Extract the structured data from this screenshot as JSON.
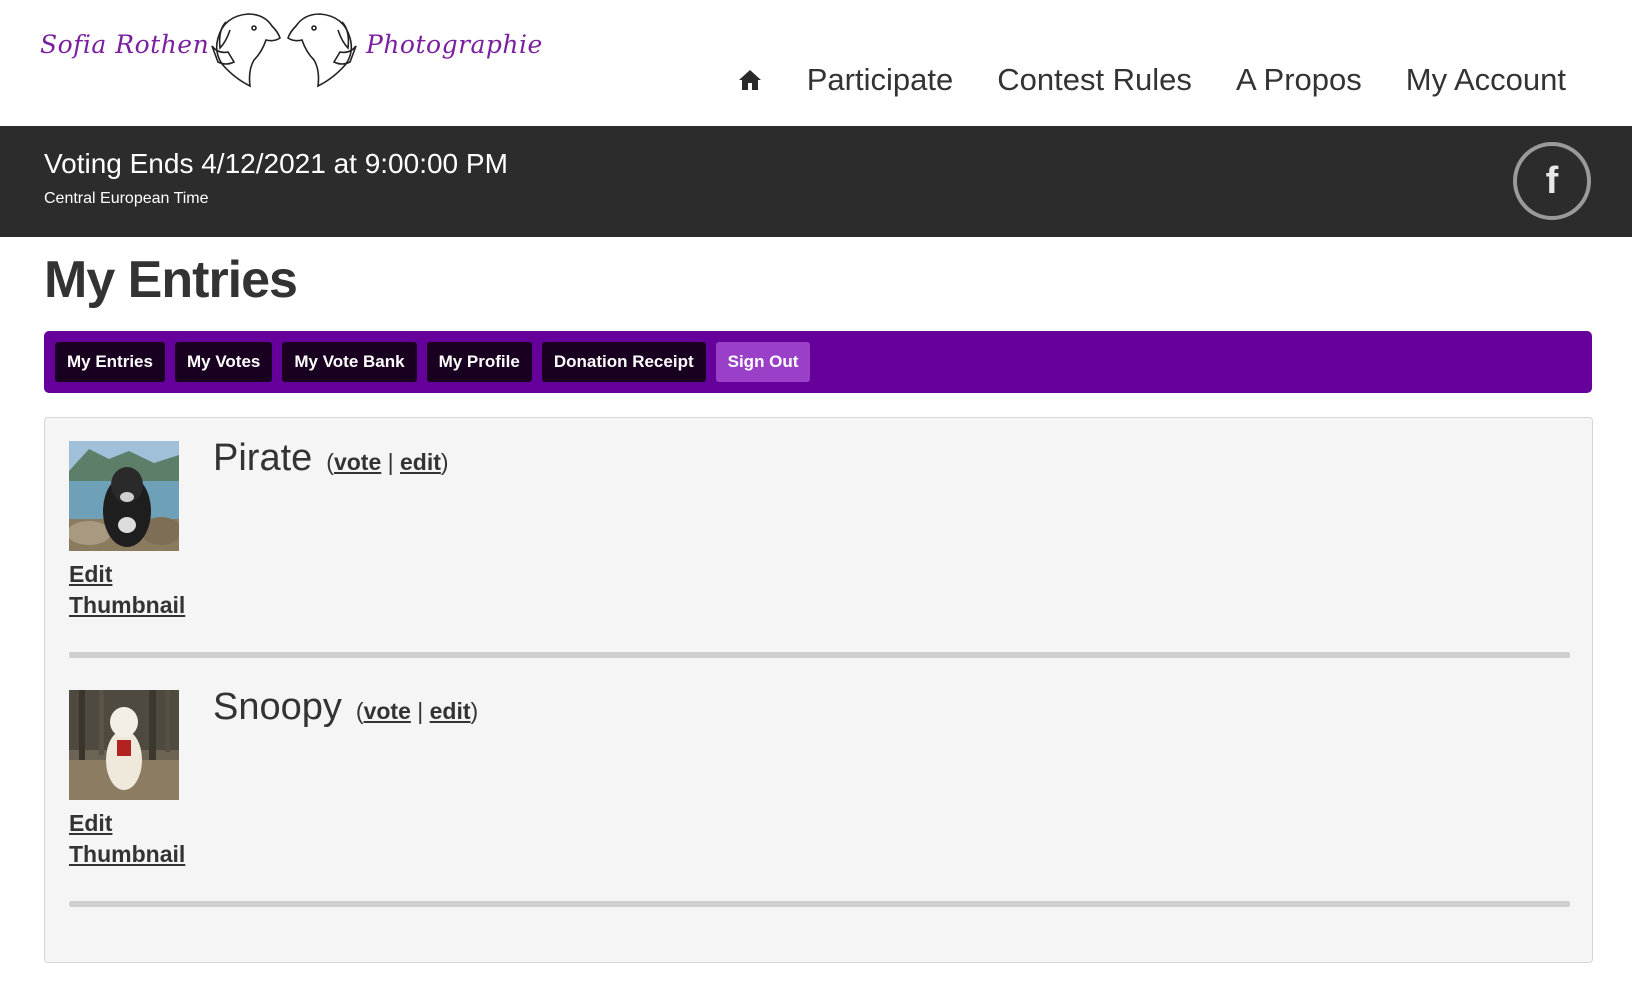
{
  "logo": {
    "left_text": "Sofia Rothen",
    "right_text": "Photographie"
  },
  "nav": {
    "home_icon": "home-icon",
    "items": [
      "Participate",
      "Contest Rules",
      "A Propos",
      "My Account"
    ]
  },
  "banner": {
    "title": "Voting Ends 4/12/2021 at 9:00:00 PM",
    "subtitle": "Central European Time",
    "social_icon": "facebook-icon"
  },
  "page": {
    "title": "My Entries"
  },
  "account_menu": {
    "items": [
      "My Entries",
      "My Votes",
      "My Vote Bank",
      "My Profile",
      "Donation Receipt",
      "Sign Out"
    ]
  },
  "entries": [
    {
      "name": "Pirate",
      "vote_label": "vote",
      "separator": "|",
      "edit_label": "edit",
      "thumbnail_link": "Edit Thumbnail"
    },
    {
      "name": "Snoopy",
      "vote_label": "vote",
      "separator": "|",
      "edit_label": "edit",
      "thumbnail_link": "Edit Thumbnail"
    }
  ],
  "colors": {
    "accent": "#66009b",
    "banner": "#2c2c2c",
    "logo": "#7a1fa0"
  }
}
